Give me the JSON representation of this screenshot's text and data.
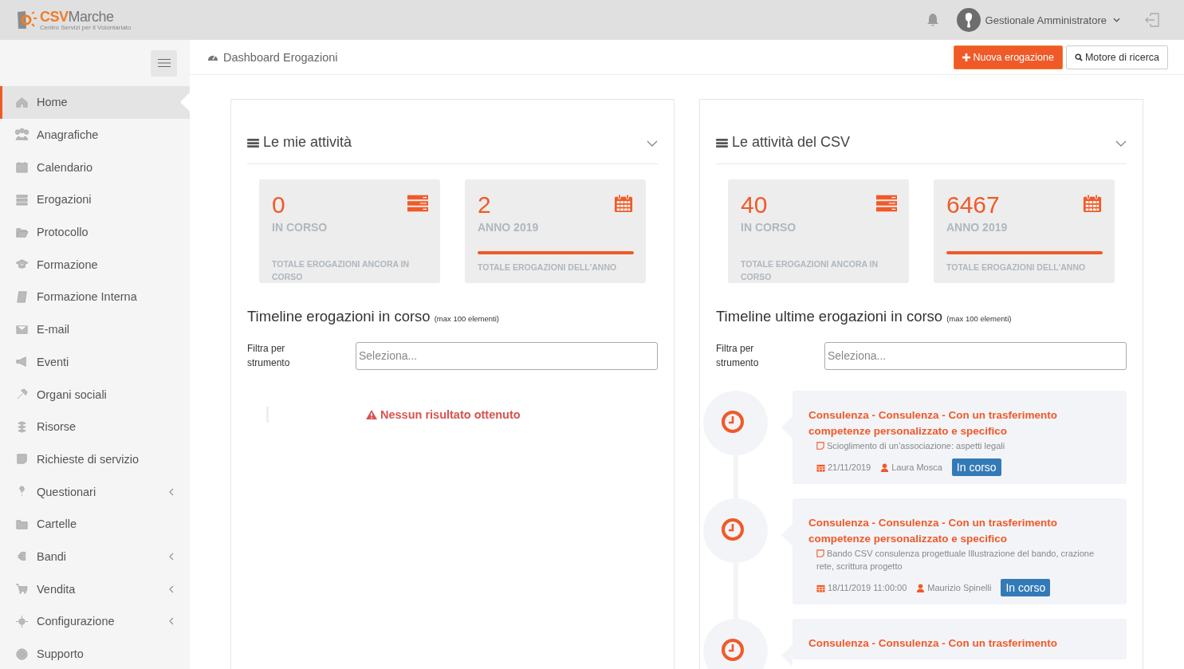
{
  "header": {
    "logo_main": "CSV",
    "logo_accent": "Marche",
    "logo_tagline": "Centro Servizi per il Volontariato",
    "user": "Gestionale Amministratore"
  },
  "sidebar": {
    "items": [
      {
        "label": "Home",
        "selected": true,
        "has_submenu": false
      },
      {
        "label": "Anagrafiche",
        "selected": false,
        "has_submenu": false
      },
      {
        "label": "Calendario",
        "selected": false,
        "has_submenu": false
      },
      {
        "label": "Erogazioni",
        "selected": false,
        "has_submenu": false
      },
      {
        "label": "Protocollo",
        "selected": false,
        "has_submenu": false
      },
      {
        "label": "Formazione",
        "selected": false,
        "has_submenu": false
      },
      {
        "label": "Formazione Interna",
        "selected": false,
        "has_submenu": false
      },
      {
        "label": "E-mail",
        "selected": false,
        "has_submenu": false
      },
      {
        "label": "Eventi",
        "selected": false,
        "has_submenu": false
      },
      {
        "label": "Organi sociali",
        "selected": false,
        "has_submenu": false
      },
      {
        "label": "Risorse",
        "selected": false,
        "has_submenu": false
      },
      {
        "label": "Richieste di servizio",
        "selected": false,
        "has_submenu": false
      },
      {
        "label": "Questionari",
        "selected": false,
        "has_submenu": true
      },
      {
        "label": "Cartelle",
        "selected": false,
        "has_submenu": false
      },
      {
        "label": "Bandi",
        "selected": false,
        "has_submenu": true
      },
      {
        "label": "Vendita",
        "selected": false,
        "has_submenu": true
      },
      {
        "label": "Configurazione",
        "selected": false,
        "has_submenu": true
      },
      {
        "label": "Supporto",
        "selected": false,
        "has_submenu": false
      }
    ]
  },
  "breadcrumb": "Dashboard Erogazioni",
  "actions": [
    {
      "label": "Nuova erogazione",
      "kind": "primary"
    },
    {
      "label": "Motore di ricerca",
      "kind": "search"
    }
  ],
  "panels": [
    {
      "title": "Le mie attività",
      "stats": [
        {
          "kind": "list",
          "value": "0",
          "label": "IN CORSO",
          "footer": "TOTALE EROGAZIONI ANCORA IN CORSO"
        },
        {
          "kind": "calendar",
          "value": "2",
          "label": "ANNO 2019",
          "footer": "TOTALE EROGAZIONI DELL'ANNO"
        }
      ],
      "timeline_title": "Timeline erogazioni in corso",
      "timeline_note": "(max 100 elementi)",
      "filter_label": "Filtra per strumento",
      "filter_placeholder": "Seleziona...",
      "empty_message": "Nessun risultato ottenuto"
    },
    {
      "title": "Le attività del CSV",
      "stats": [
        {
          "kind": "list",
          "value": "40",
          "label": "IN CORSO",
          "footer": "TOTALE EROGAZIONI ANCORA IN CORSO"
        },
        {
          "kind": "calendar",
          "value": "6467",
          "label": "ANNO 2019",
          "footer": "TOTALE EROGAZIONI DELL'ANNO"
        }
      ],
      "timeline_title": "Timeline ultime erogazioni in corso",
      "timeline_note": "(max 100 elementi)",
      "filter_label": "Filtra per strumento",
      "filter_placeholder": "Seleziona...",
      "items": [
        {
          "title": "Consulenza - Consulenza - Con un trasferimento competenze personalizzato e specifico",
          "subject": "Scioglimento di un’associazione: aspetti legali",
          "date": "21/11/2019",
          "person": "Laura Mosca",
          "status": "In corso"
        },
        {
          "title": "Consulenza - Consulenza - Con un trasferimento competenze personalizzato e specifico",
          "subject": "Bando CSV consulenza progettuale Illustrazione del bando, crazione rete, scrittura progetto",
          "date": "18/11/2019 11:00:00",
          "person": "Maurizio Spinelli",
          "status": "In corso"
        },
        {
          "title": "Consulenza - Consulenza - Con un trasferimento"
        }
      ]
    }
  ]
}
